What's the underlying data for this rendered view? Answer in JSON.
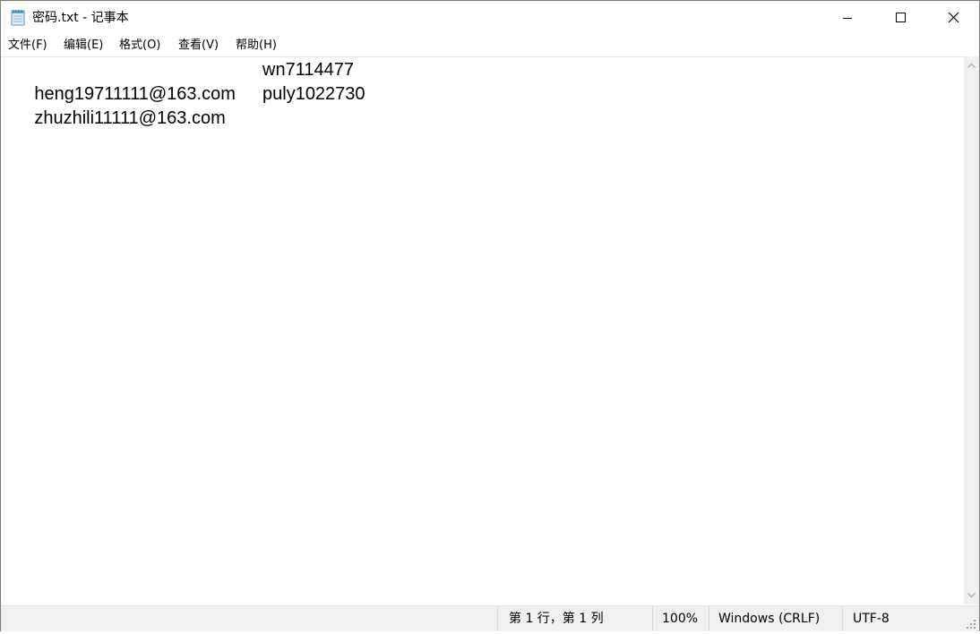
{
  "window": {
    "title": "密码.txt - 记事本",
    "app_icon": "notepad-icon",
    "controls": {
      "minimize_icon": "minimize-icon",
      "maximize_icon": "maximize-icon",
      "close_icon": "close-icon"
    }
  },
  "menu": {
    "items": [
      {
        "label": "文件(F)"
      },
      {
        "label": "编辑(E)"
      },
      {
        "label": "格式(O)"
      },
      {
        "label": "查看(V)"
      },
      {
        "label": "帮助(H)"
      }
    ]
  },
  "document": {
    "lines": [
      {
        "col1": "heng19711111@163.com",
        "col2": "wn7114477"
      },
      {
        "col1": "zhuzhili11111@163.com",
        "col2": "puly1022730"
      }
    ]
  },
  "status": {
    "position": "第 1 行，第 1 列",
    "zoom": "100%",
    "line_ending": "Windows (CRLF)",
    "encoding": "UTF-8"
  },
  "colors": {
    "text": "#000000",
    "chrome": "#f0f0f0",
    "border": "#7a7a7a"
  }
}
